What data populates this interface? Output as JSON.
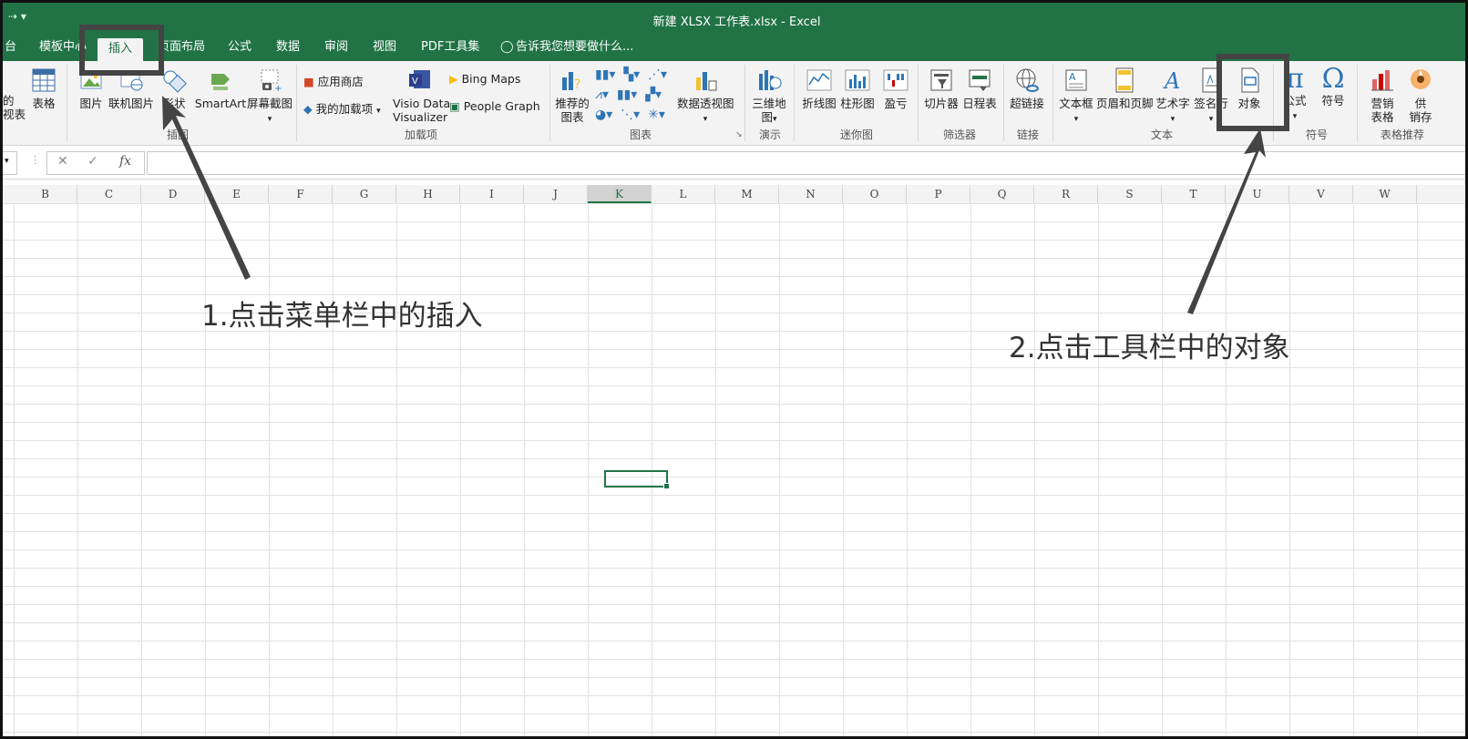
{
  "window": {
    "title": "新建 XLSX 工作表.xlsx - Excel",
    "qat_symbol": "⇢ ▾"
  },
  "tabs": [
    {
      "label": "台"
    },
    {
      "label": "模板中心"
    },
    {
      "label": "插入"
    },
    {
      "label": "页面布局"
    },
    {
      "label": "公式"
    },
    {
      "label": "数据"
    },
    {
      "label": "审阅"
    },
    {
      "label": "视图"
    },
    {
      "label": "PDF工具集"
    },
    {
      "label": "告诉我您想要做什么..."
    }
  ],
  "ribbon": {
    "tables": {
      "cut_label_line1": "的",
      "cut_label_line2": "视表",
      "table": "表格"
    },
    "illustrations": {
      "pictures": "图片",
      "online_pictures": "联机图片",
      "shapes": "形状",
      "smartart": "SmartArt",
      "screenshot": "屏幕截图",
      "group": "插图"
    },
    "addins": {
      "store": "应用商店",
      "my_addins": "我的加载项",
      "visio_line1": "Visio Data",
      "visio_line2": "Visualizer",
      "bing_maps": "Bing Maps",
      "people_graph": "People Graph",
      "group": "加载项"
    },
    "charts": {
      "recommended_line1": "推荐的",
      "recommended_line2": "图表",
      "pivot_chart": "数据透视图",
      "group": "图表"
    },
    "tours": {
      "map_line1": "三维地",
      "map_line2": "图",
      "group": "演示"
    },
    "sparklines": {
      "line": "折线图",
      "column": "柱形图",
      "winloss": "盈亏",
      "group": "迷你图"
    },
    "filters": {
      "slicer": "切片器",
      "timeline": "日程表",
      "group": "筛选器"
    },
    "links": {
      "hyperlink": "超链接",
      "group": "链接"
    },
    "text": {
      "textbox": "文本框",
      "header_footer": "页眉和页脚",
      "wordart": "艺术字",
      "signature": "签名行",
      "object": "对象",
      "group": "文本"
    },
    "symbols": {
      "equation": "公式",
      "symbol": "符号",
      "group": "符号"
    },
    "recommend": {
      "sales_line1": "营销",
      "sales_line2": "表格",
      "supply_line1": "供",
      "supply_line2": "销存",
      "group": "表格推荐"
    }
  },
  "formula_bar": {
    "cancel": "✕",
    "enter": "✓",
    "fx": "fx",
    "value": ""
  },
  "columns": [
    "B",
    "C",
    "D",
    "E",
    "F",
    "G",
    "H",
    "I",
    "J",
    "K",
    "L",
    "M",
    "N",
    "O",
    "P",
    "Q",
    "R",
    "S",
    "T",
    "U",
    "V",
    "W"
  ],
  "selected_column": "K",
  "annotations": {
    "step1": "1.点击菜单栏中的插入",
    "step2": "2.点击工具栏中的对象"
  }
}
